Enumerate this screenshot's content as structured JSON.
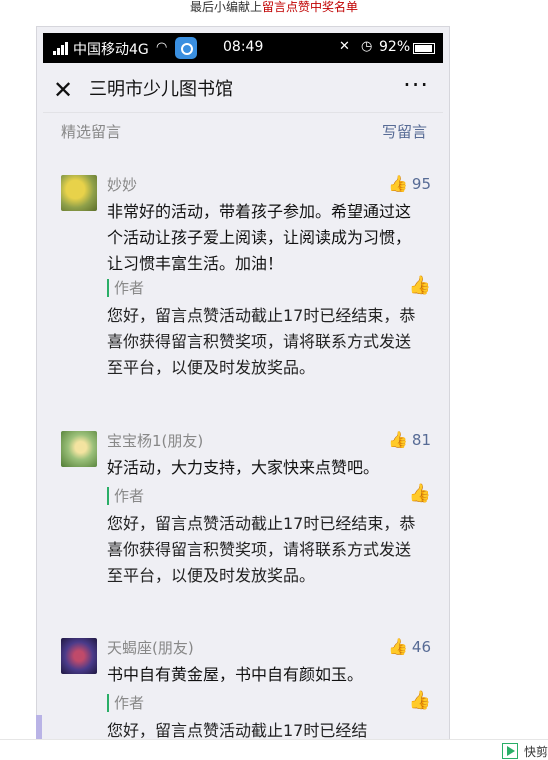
{
  "caption": {
    "prefix": "最后小编献上",
    "highlight": "留言点赞中奖名单"
  },
  "statusbar": {
    "carrier": "中国移动4G",
    "time": "08:49",
    "battery": "92%"
  },
  "navbar": {
    "title": "三明市少儿图书馆",
    "more": "···"
  },
  "section": {
    "left": "精选留言",
    "right": "写留言"
  },
  "comments": [
    {
      "nickname": "妙妙",
      "likes": "95",
      "body": "非常好的活动，带着孩子参加。希望通过这个活动让孩子爱上阅读，让阅读成为习惯，让习惯丰富生活。加油！",
      "reply_tag": "作者",
      "reply": "您好，留言点赞活动截止17时已经结束，恭喜你获得留言积赞奖项，请将联系方式发送至平台，以便及时发放奖品。"
    },
    {
      "nickname": "宝宝杨1(朋友)",
      "likes": "81",
      "body": "好活动，大力支持，大家快来点赞吧。",
      "reply_tag": "作者",
      "reply": "您好，留言点赞活动截止17时已经结束，恭喜你获得留言积赞奖项，请将联系方式发送至平台，以便及时发放奖品。"
    },
    {
      "nickname": "天蝎座(朋友)",
      "likes": "46",
      "body": "书中自有黄金屋，书中自有颜如玉。",
      "reply_tag": "作者",
      "reply": "您好，留言点赞活动截止17时已经结"
    }
  ],
  "footer": {
    "label": "快剪"
  },
  "icons": {
    "close": "close-icon",
    "more": "more-icon",
    "like": "thumbs-up-icon",
    "avatar": "avatar"
  }
}
